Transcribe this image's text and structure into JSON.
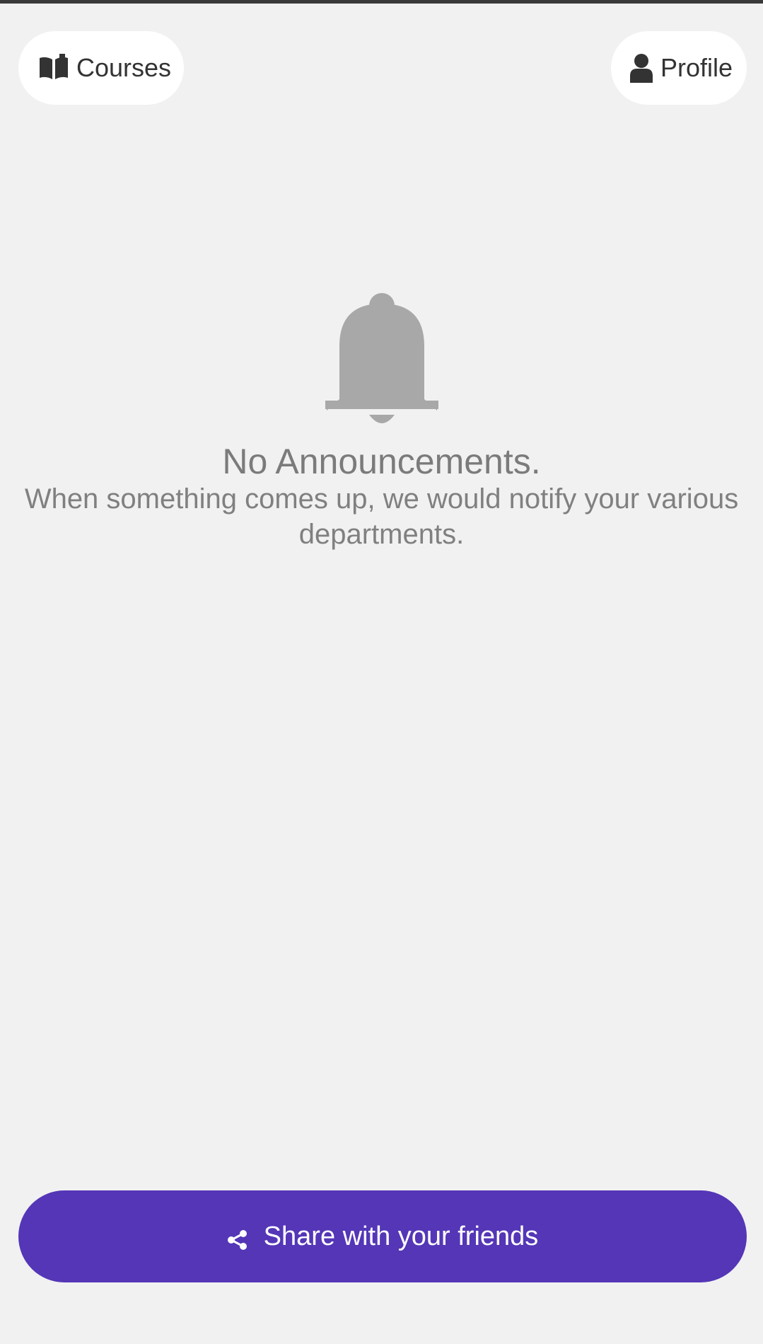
{
  "header": {
    "courses_label": "Courses",
    "courses_icon": "book-open-icon",
    "profile_label": "Profile",
    "profile_icon": "user-icon"
  },
  "empty_state": {
    "icon": "bell-icon",
    "title": "No Announcements.",
    "message": "When something comes up, we would notify your various departments."
  },
  "footer": {
    "share_label": "Share with your friends",
    "share_icon": "share-icon"
  },
  "colors": {
    "background": "#f1f1f1",
    "accent": "#5436b7",
    "pill_background": "#ffffff",
    "muted_text": "#7b7b7b",
    "icon_gray": "#a8a8a8"
  }
}
